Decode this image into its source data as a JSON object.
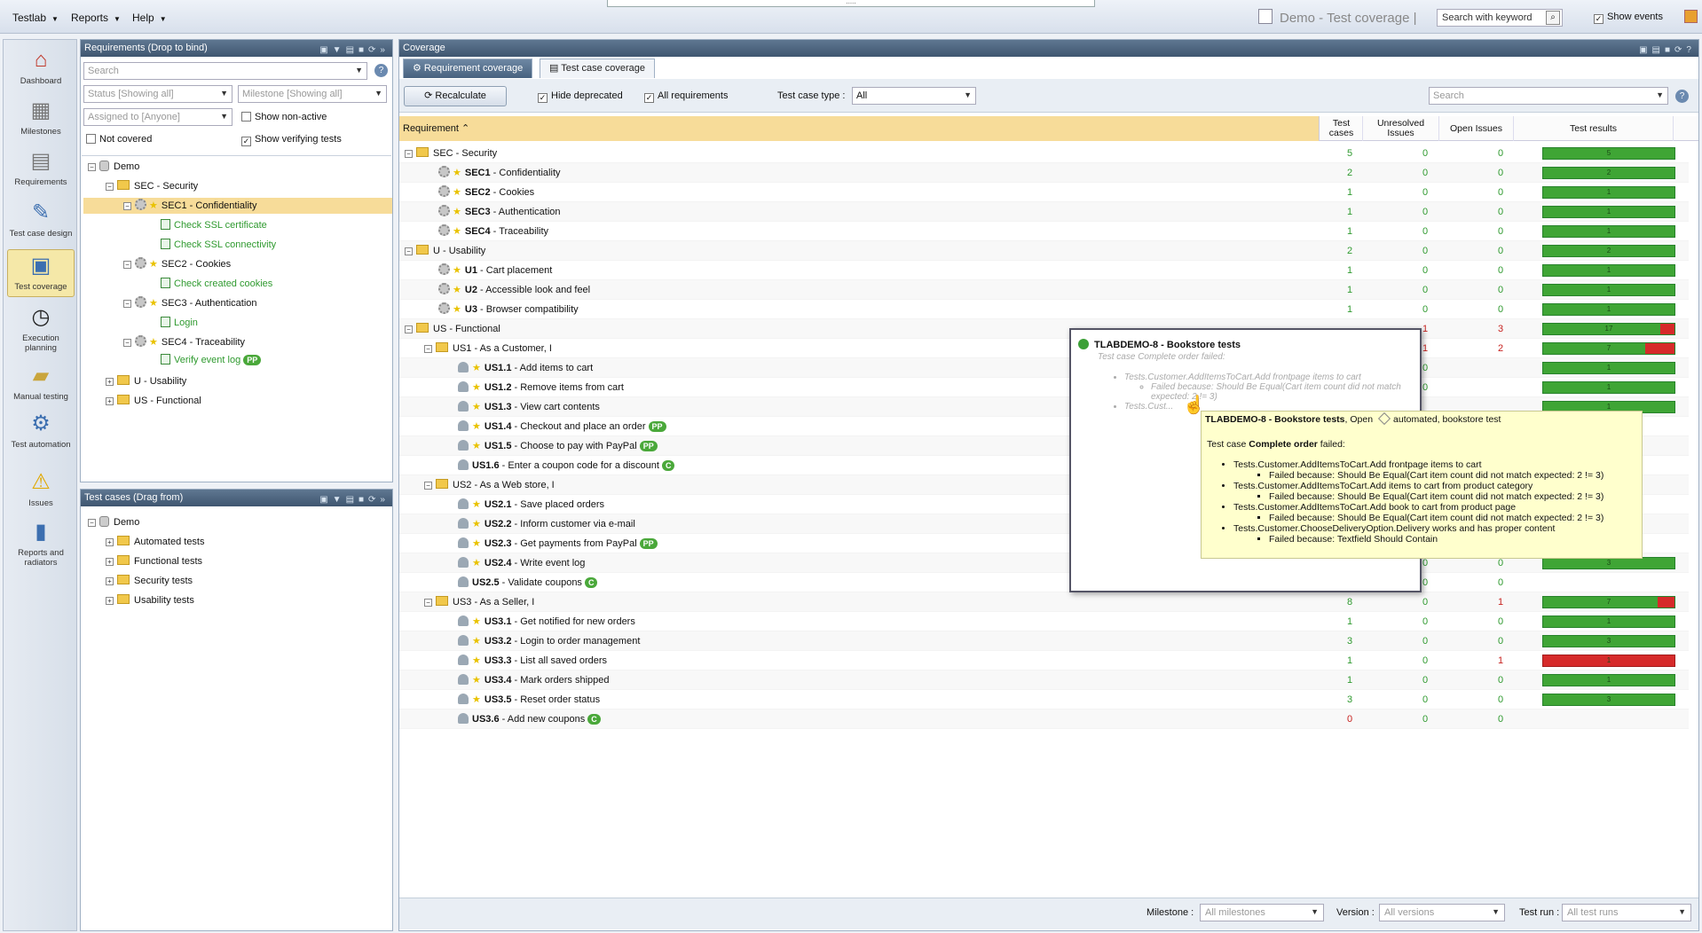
{
  "menu": {
    "testlab": "Testlab",
    "reports": "Reports",
    "help": "Help"
  },
  "top": {
    "project": "Demo - Test coverage",
    "search_placeholder": "Search with keyword",
    "show_events": "Show events"
  },
  "nav": [
    {
      "icon": "house-icon",
      "label": "Dashboard"
    },
    {
      "icon": "calendar-icon",
      "label": "Milestones"
    },
    {
      "icon": "requirements-icon",
      "label": "Requirements"
    },
    {
      "icon": "test-case-design-icon",
      "label": "Test case design"
    },
    {
      "icon": "test-coverage-icon",
      "label": "Test coverage"
    },
    {
      "icon": "clock-icon",
      "label": "Execution planning"
    },
    {
      "icon": "book-icon",
      "label": "Manual testing"
    },
    {
      "icon": "automation-icon",
      "label": "Test automation"
    },
    {
      "icon": "warning-icon",
      "label": "Issues"
    },
    {
      "icon": "bar-chart-icon",
      "label": "Reports and radiators"
    }
  ],
  "req_panel": {
    "title": "Requirements (Drop to bind)",
    "search": "Search",
    "status": "Status [Showing all]",
    "milestone": "Milestone [Showing all]",
    "assigned": "Assigned to [Anyone]",
    "show_nonactive": "Show non-active",
    "not_covered": "Not covered",
    "show_verifying": "Show verifying tests",
    "tree": [
      {
        "t": "Demo"
      },
      {
        "t": "SEC - Security"
      },
      {
        "t": "SEC1 - Confidentiality"
      },
      {
        "t": "Check SSL certificate"
      },
      {
        "t": "Check SSL connectivity"
      },
      {
        "t": "SEC2 - Cookies"
      },
      {
        "t": "Check created cookies"
      },
      {
        "t": "SEC3 - Authentication"
      },
      {
        "t": "Login"
      },
      {
        "t": "SEC4 - Traceability"
      },
      {
        "t": "Verify event log",
        "pill": "PP"
      },
      {
        "t": "U - Usability"
      },
      {
        "t": "US - Functional"
      }
    ]
  },
  "tc_panel": {
    "title": "Test cases (Drag from)",
    "tree": [
      {
        "t": "Demo"
      },
      {
        "t": "Automated tests"
      },
      {
        "t": "Functional tests"
      },
      {
        "t": "Security tests"
      },
      {
        "t": "Usability tests"
      }
    ]
  },
  "coverage": {
    "title": "Coverage",
    "tabs": [
      "Requirement coverage",
      "Test case coverage"
    ],
    "recalc": "Recalculate",
    "hide_deprecated": "Hide deprecated",
    "all_requirements": "All requirements",
    "type_label": "Test case type :",
    "type_value": "All",
    "search": "Search",
    "columns": {
      "req": "Requirement",
      "tc": "Test cases",
      "unres": "Unresolved Issues",
      "open": "Open Issues",
      "results": "Test results"
    },
    "rows": [
      {
        "label": "SEC - Security",
        "tc": "5",
        "un": "0",
        "op": "0",
        "pass": 5,
        "fail": 0
      },
      {
        "label": "SEC1 - Confidentiality",
        "tc": "2",
        "un": "0",
        "op": "0",
        "pass": 2,
        "fail": 0
      },
      {
        "label": "SEC2 - Cookies",
        "tc": "1",
        "un": "0",
        "op": "0",
        "pass": 1,
        "fail": 0
      },
      {
        "label": "SEC3 - Authentication",
        "tc": "1",
        "un": "0",
        "op": "0",
        "pass": 1,
        "fail": 0
      },
      {
        "label": "SEC4 - Traceability",
        "tc": "1",
        "un": "0",
        "op": "0",
        "pass": 1,
        "fail": 0
      },
      {
        "label": "U - Usability",
        "tc": "2",
        "un": "0",
        "op": "0",
        "pass": 2,
        "fail": 0
      },
      {
        "label": "U1 - Cart placement",
        "tc": "1",
        "un": "0",
        "op": "0",
        "pass": 1,
        "fail": 0
      },
      {
        "label": "U2 - Accessible look and feel",
        "tc": "1",
        "un": "0",
        "op": "0",
        "pass": 1,
        "fail": 0
      },
      {
        "label": "U3 - Browser compatibility",
        "tc": "1",
        "un": "0",
        "op": "0",
        "pass": 1,
        "fail": 0
      },
      {
        "label": "US - Functional",
        "tc": "",
        "un": "1",
        "op": "3",
        "pass": 17,
        "fail": 2
      },
      {
        "label": "US1 - As a Customer, I",
        "tc": "",
        "un": "1",
        "op": "2",
        "pass": 7,
        "fail": 2
      },
      {
        "label": "US1.1 - Add items to cart",
        "tc": "",
        "un": "0",
        "op": "",
        "pass": 1,
        "fail": 0
      },
      {
        "label": "US1.2 - Remove items from cart",
        "tc": "",
        "un": "0",
        "op": "",
        "pass": 1,
        "fail": 0
      },
      {
        "label": "US1.3 - View cart contents",
        "tc": "",
        "un": "",
        "op": "",
        "pass": 1,
        "fail": 0
      },
      {
        "label": "US1.4 - Checkout and place an order",
        "pill": "PP",
        "tc": "",
        "un": "",
        "op": "",
        "pass": null,
        "fail": null
      },
      {
        "label": "US1.5 - Choose to pay with PayPal",
        "pill": "PP",
        "tc": "",
        "un": "",
        "op": "",
        "pass": null,
        "fail": null
      },
      {
        "label": "US1.6 - Enter a coupon code for a discount",
        "pill": "C",
        "tc": "",
        "un": "",
        "op": "",
        "pass": null,
        "fail": null
      },
      {
        "label": "US2 - As a Web store, I",
        "tc": "",
        "un": "",
        "op": "",
        "pass": null,
        "fail": null
      },
      {
        "label": "US2.1 - Save placed orders",
        "tc": "",
        "un": "",
        "op": "",
        "pass": null,
        "fail": null
      },
      {
        "label": "US2.2 - Inform customer via e-mail",
        "tc": "",
        "un": "",
        "op": "",
        "pass": null,
        "fail": null
      },
      {
        "label": "US2.3 - Get payments from PayPal",
        "pill": "PP",
        "tc": "",
        "un": "",
        "op": "",
        "pass": null,
        "fail": null
      },
      {
        "label": "US2.4 - Write event log",
        "tc": "",
        "un": "0",
        "op": "0",
        "pass": 3,
        "fail": 0
      },
      {
        "label": "US2.5 - Validate coupons",
        "pill": "C",
        "tc": "",
        "un": "0",
        "op": "0",
        "pass": null,
        "fail": null
      },
      {
        "label": "US3 - As a Seller, I",
        "tc": "8",
        "un": "0",
        "op": "1",
        "pass": 7,
        "fail": 1
      },
      {
        "label": "US3.1 - Get notified for new orders",
        "tc": "1",
        "un": "0",
        "op": "0",
        "pass": 1,
        "fail": 0
      },
      {
        "label": "US3.2 - Login to order management",
        "tc": "3",
        "un": "0",
        "op": "0",
        "pass": 3,
        "fail": 0
      },
      {
        "label": "US3.3 - List all saved orders",
        "tc": "1",
        "un": "0",
        "op": "1",
        "pass": 0,
        "fail": 1
      },
      {
        "label": "US3.4 - Mark orders shipped",
        "tc": "1",
        "un": "0",
        "op": "0",
        "pass": 1,
        "fail": 0
      },
      {
        "label": "US3.5 - Reset order status",
        "tc": "3",
        "un": "0",
        "op": "0",
        "pass": 3,
        "fail": 0
      },
      {
        "label": "US3.6 - Add new coupons",
        "pill": "C",
        "tc": "0",
        "un": "0",
        "op": "0",
        "pass": null,
        "fail": null
      }
    ]
  },
  "popup": {
    "title": "TLABDEMO-8 - Bookstore tests",
    "sub": "Test case Complete order failed:",
    "lines": [
      "Tests.Customer.AddItemsToCart.Add frontpage items to cart",
      "Failed because: Should Be Equal(Cart item count did not match expected: 2 != 3)",
      "Tests.Cust..."
    ]
  },
  "tooltip": {
    "title": "TLABDEMO-8 - Bookstore tests",
    "status": ", Open",
    "tags": "automated, bookstore test",
    "intro_pre": "Test case ",
    "intro_bold": "Complete order",
    "intro_post": " failed:",
    "items": [
      {
        "test": "Tests.Customer.AddItemsToCart.Add frontpage items to cart",
        "why": "Failed because: Should Be Equal(Cart item count did not match expected: 2 != 3)"
      },
      {
        "test": "Tests.Customer.AddItemsToCart.Add items to cart from product category",
        "why": "Failed because: Should Be Equal(Cart item count did not match expected: 2 != 3)"
      },
      {
        "test": "Tests.Customer.AddItemsToCart.Add book to cart from product page",
        "why": "Failed because: Should Be Equal(Cart item count did not match expected: 2 != 3)"
      },
      {
        "test": "Tests.Customer.ChooseDeliveryOption.Delivery works and has proper content",
        "why": "Failed because: Textfield Should Contain"
      }
    ]
  },
  "footer": {
    "milestone_label": "Milestone :",
    "milestone": "All milestones",
    "version_label": "Version :",
    "version": "All versions",
    "run_label": "Test run :",
    "run": "All test runs"
  },
  "colors": {
    "pass": "#3fa535",
    "fail": "#d62a2a",
    "header": "#48627f",
    "selected": "#f7dc99"
  }
}
